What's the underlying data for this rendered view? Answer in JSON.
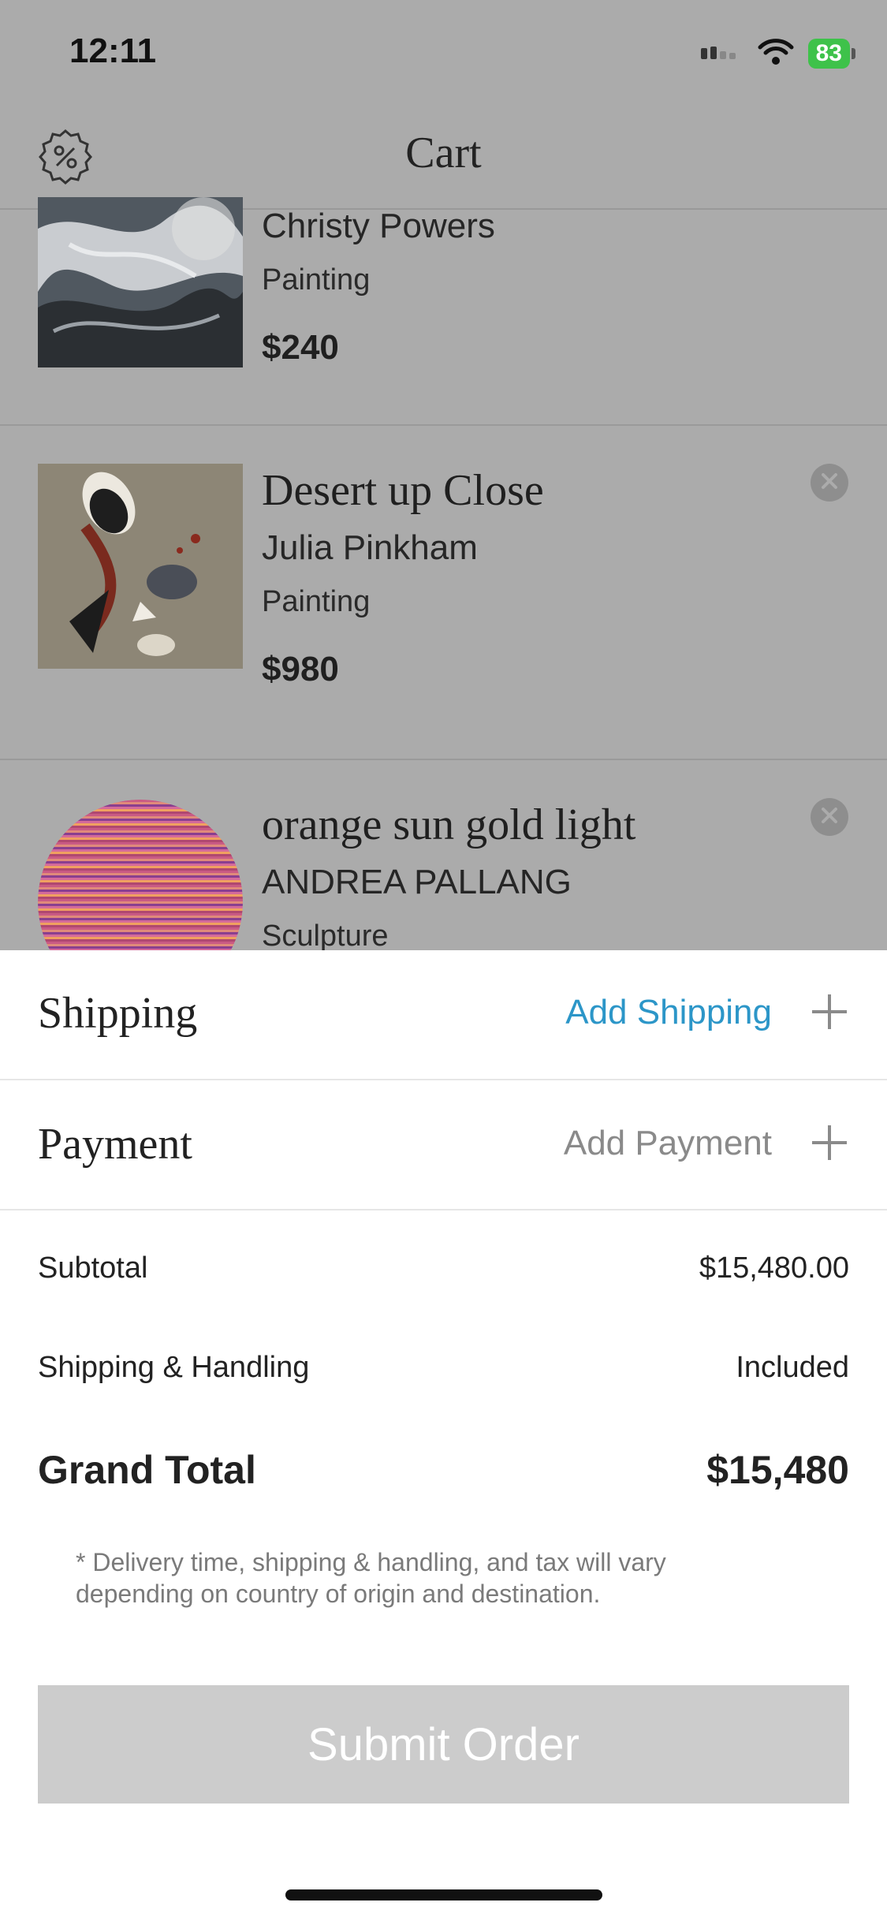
{
  "status_bar": {
    "time": "12:11",
    "battery": "83"
  },
  "nav": {
    "title": "Cart"
  },
  "cart_items": [
    {
      "title": "",
      "artist": "Christy Powers",
      "category": "Painting",
      "price": "$240"
    },
    {
      "title": "Desert up Close",
      "artist": "Julia Pinkham",
      "category": "Painting",
      "price": "$980"
    },
    {
      "title": "orange sun gold light",
      "artist": "ANDREA PALLANG",
      "category": "Sculpture",
      "price": ""
    }
  ],
  "shipping": {
    "label": "Shipping",
    "action": "Add Shipping",
    "action_color": "#2c96c8"
  },
  "payment": {
    "label": "Payment",
    "action": "Add Payment",
    "action_color": "#8a8a8a"
  },
  "summary": {
    "subtotal_label": "Subtotal",
    "subtotal_value": "$15,480.00",
    "shipping_label": "Shipping & Handling",
    "shipping_value": "Included",
    "grand_label": "Grand Total",
    "grand_value": "$15,480"
  },
  "disclaimer": "* Delivery time, shipping & handling, and tax will vary depending on country of origin and destination.",
  "submit_label": "Submit Order",
  "icons": {
    "discount": "discount-badge-icon",
    "remove": "close-icon",
    "plus": "plus-icon",
    "wifi": "wifi-icon",
    "signal": "signal-icon",
    "battery": "battery-icon"
  }
}
